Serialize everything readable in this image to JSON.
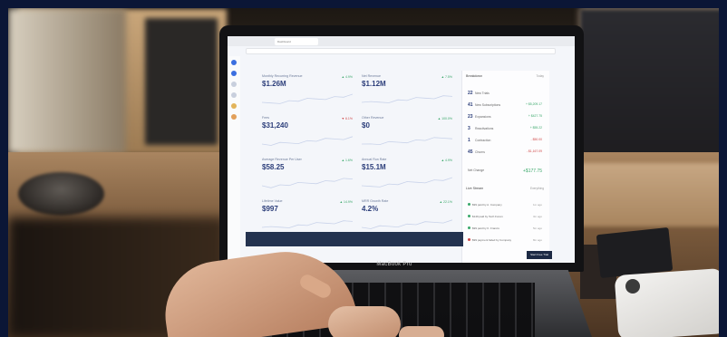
{
  "scene": {
    "laptop_brand": "MacBook Pro"
  },
  "browser": {
    "tab_title": "Dashboard"
  },
  "dashboard": {
    "cards": [
      {
        "label": "Monthly Recurring Revenue",
        "value": "$1.26M",
        "delta": "▲ 4.9%",
        "delta_color": "#3aa86a"
      },
      {
        "label": "Net Revenue",
        "value": "$1.12M",
        "delta": "▲ 7.5%",
        "delta_color": "#3aa86a"
      },
      {
        "label": "Fees",
        "value": "$31,240",
        "delta": "▼ 6.1%",
        "delta_color": "#d04848"
      },
      {
        "label": "Other Revenue",
        "value": "$0",
        "delta": "▲ 100.0%",
        "delta_color": "#3aa86a"
      },
      {
        "label": "Average Revenue Per User",
        "value": "$58.25",
        "delta": "▲ 1.6%",
        "delta_color": "#3aa86a"
      },
      {
        "label": "Annual Run Rate",
        "value": "$15.1M",
        "delta": "▲ 4.9%",
        "delta_color": "#3aa86a"
      },
      {
        "label": "Lifetime Value",
        "value": "$997",
        "delta": "▲ 14.9%",
        "delta_color": "#3aa86a"
      },
      {
        "label": "MRR Growth Rate",
        "value": "4.2%",
        "delta": "▲ 22.1%",
        "delta_color": "#3aa86a"
      }
    ],
    "breakdown": {
      "title": "Breakdown",
      "period": "Today",
      "rows": [
        {
          "n": "22",
          "label": "New Trials",
          "value": ""
        },
        {
          "n": "41",
          "label": "New Subscriptions",
          "value": "+ $5,209.17"
        },
        {
          "n": "23",
          "label": "Expansions",
          "value": "+ $427.75"
        },
        {
          "n": "3",
          "label": "Reactivations",
          "value": "+ $55.22"
        },
        {
          "n": "1",
          "label": "Contraction",
          "value": "- $50.00"
        },
        {
          "n": "45",
          "label": "Churns",
          "value": "- $1,167.09"
        }
      ],
      "net_change_label": "Net Change",
      "net_change_value": "+$177.75"
    },
    "live_stream": {
      "title": "Live Stream",
      "filter": "Everything",
      "rows": [
        {
          "text": "$99 paid by A. Company",
          "time": "1m ago",
          "color": "#3aa86a"
        },
        {
          "text": "$149 paid by Tech Forum",
          "time": "3m ago",
          "color": "#3aa86a"
        },
        {
          "text": "$99 paid by K. Francis",
          "time": "5m ago",
          "color": "#3aa86a"
        },
        {
          "text": "$99 payment failed by Company",
          "time": "8m ago",
          "color": "#d04848"
        }
      ]
    },
    "cta": "Start Free Trial"
  }
}
